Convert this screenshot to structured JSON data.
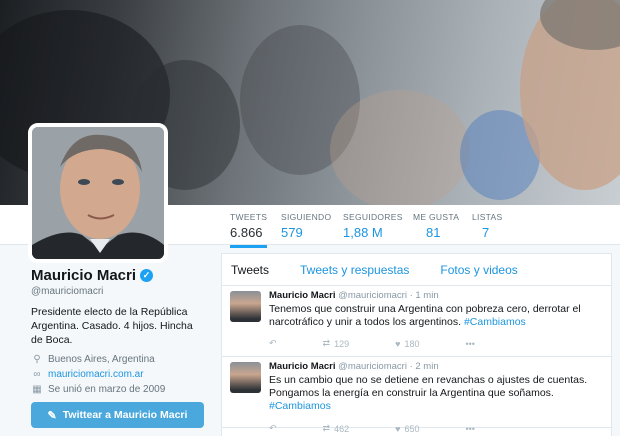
{
  "nav": {
    "items": [
      {
        "label": "TWEETS",
        "value": "6.866"
      },
      {
        "label": "SIGUIENDO",
        "value": "579"
      },
      {
        "label": "SEGUIDORES",
        "value": "1,88 M"
      },
      {
        "label": "ME GUSTA",
        "value": "81"
      },
      {
        "label": "LISTAS",
        "value": "7"
      }
    ]
  },
  "profile": {
    "name": "Mauricio Macri",
    "verified_icon": "✓",
    "handle": "@mauriciomacri",
    "bio": "Presidente electo de la República Argentina. Casado. 4 hijos. Hincha de Boca.",
    "location": "Buenos Aires, Argentina",
    "website": "mauriciomacri.com.ar",
    "joined": "Se unió en marzo de 2009",
    "tweet_button": "Twittear a Mauricio Macri"
  },
  "timeline": {
    "tabs": [
      "Tweets",
      "Tweets y respuestas",
      "Fotos y videos"
    ],
    "tweets": [
      {
        "author": "Mauricio Macri",
        "handle": "@mauriciomacri",
        "time": "· 1 min",
        "text": "Tenemos que construir una Argentina con pobreza cero, derrotar el narcotráfico y unir a todos los argentinos. ",
        "hashtag": "#Cambiamos",
        "retweets": "129",
        "likes": "180"
      },
      {
        "author": "Mauricio Macri",
        "handle": "@mauriciomacri",
        "time": "· 2 min",
        "text": "Es un cambio que no se detiene en revanchas o ajustes de cuentas. Pongamos la energía en construir la Argentina que soñamos. ",
        "hashtag": "#Cambiamos",
        "retweets": "462",
        "likes": "650"
      }
    ]
  },
  "icons": {
    "location": "location-pin-icon",
    "link": "link-icon",
    "calendar": "calendar-icon",
    "reply": "reply-icon",
    "retweet": "retweet-icon",
    "like": "heart-icon",
    "more": "more-icon",
    "compose": "compose-icon"
  },
  "colors": {
    "accent": "#1da1f2",
    "link": "#1b95e0",
    "button": "#4aa8dd"
  }
}
